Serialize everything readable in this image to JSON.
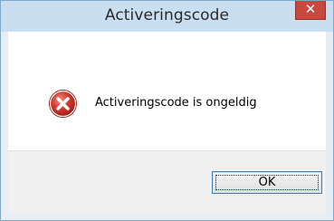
{
  "dialog": {
    "title": "Activeringscode",
    "close_glyph": "✕",
    "message": "Activeringscode is ongeldig",
    "icon": "error-icon",
    "ok_label": "OK"
  },
  "colors": {
    "titlebar": "#c9def1",
    "close_button": "#c7483e",
    "error_icon": "#c8322a",
    "button_area": "#f0f0f0"
  }
}
